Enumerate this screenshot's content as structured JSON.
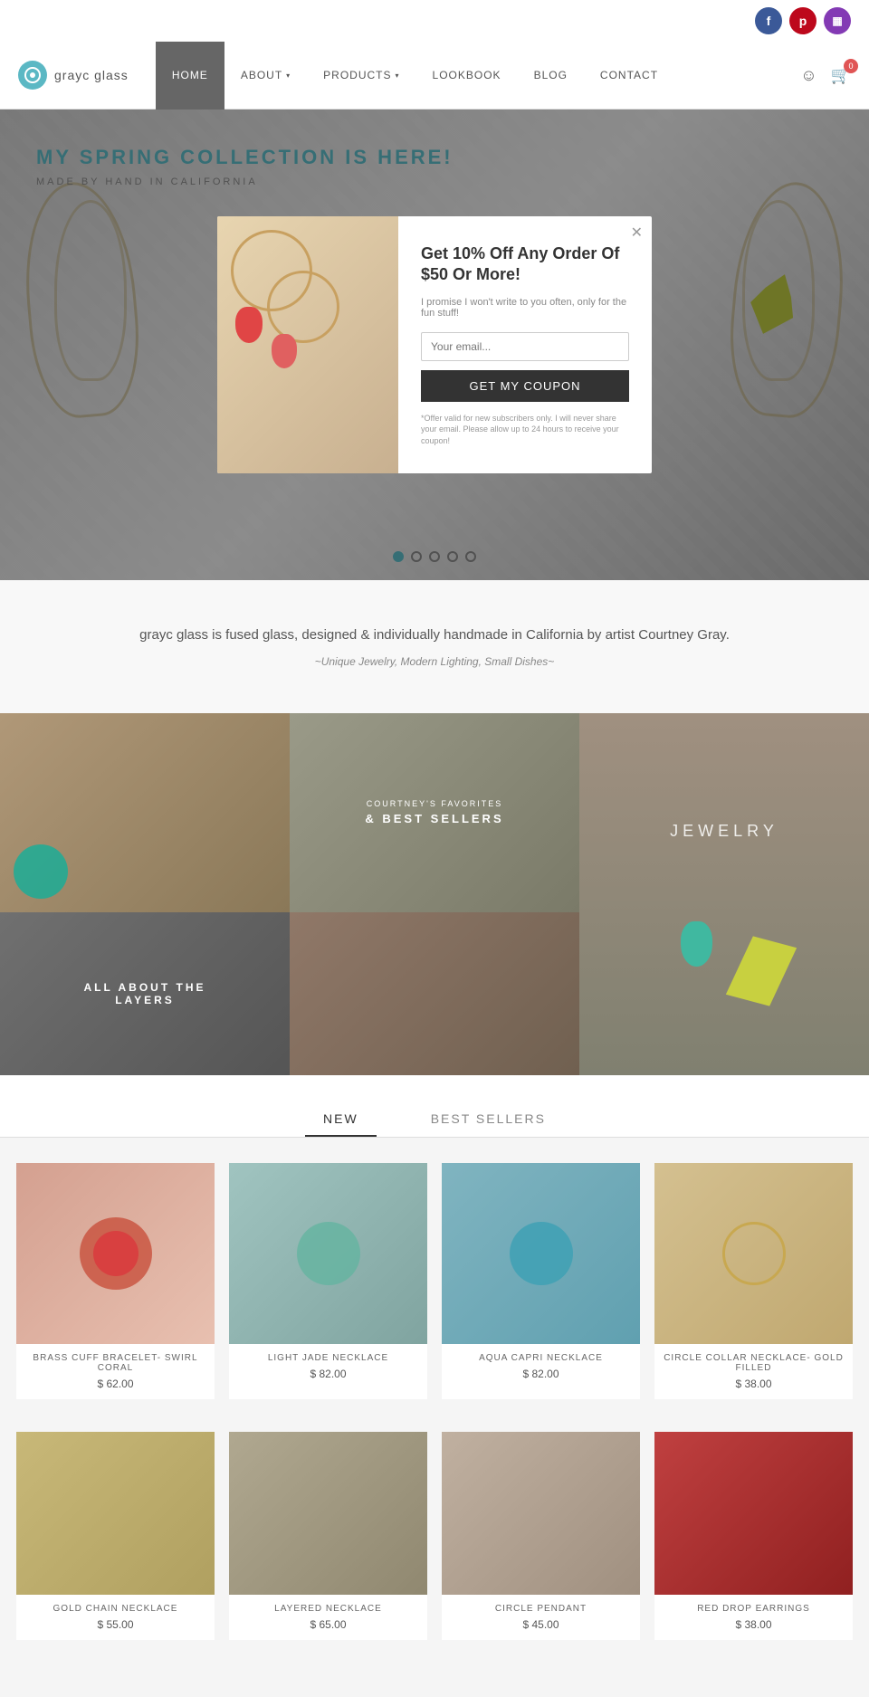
{
  "social": {
    "facebook_label": "f",
    "pinterest_label": "p",
    "instagram_label": "📷"
  },
  "nav": {
    "logo_text": "grayc glass",
    "items": [
      {
        "label": "HOME",
        "active": true
      },
      {
        "label": "ABOUT",
        "has_arrow": true,
        "active": false
      },
      {
        "label": "PRODUCTS",
        "has_arrow": true,
        "active": false
      },
      {
        "label": "LOOKBOOK",
        "active": false
      },
      {
        "label": "BLOG",
        "active": false
      },
      {
        "label": "CONTACT",
        "active": false
      }
    ],
    "cart_count": "0"
  },
  "hero": {
    "title": "MY SPRING COLLECTION IS HERE!",
    "subtitle": "MADE BY HAND IN CALIFORNIA"
  },
  "popup": {
    "title": "Get 10% Off Any Order Of $50 Or More!",
    "subtitle": "I promise I won't write to you often, only for the fun stuff!",
    "email_placeholder": "Your email...",
    "button_label": "Get My Coupon",
    "disclaimer": "*Offer valid for new subscribers only. I will never share your email. Please allow up to 24 hours to receive your coupon!"
  },
  "slider_dots": [
    {
      "active": true
    },
    {
      "active": false
    },
    {
      "active": false
    },
    {
      "active": false
    },
    {
      "active": false
    }
  ],
  "about": {
    "main_text": "grayc glass is fused glass, designed & individually handmade in California by artist Courtney Gray.",
    "sub_text": "~Unique Jewelry, Modern Lighting, Small Dishes~"
  },
  "grid_sections": {
    "cell1_label": "COURTNEY'S FAVORITES\n& BEST SELLERS",
    "cell2_label": "ALL ABOUT THE\nLAYERS",
    "cell3_label": "JEWELRY"
  },
  "tabs": {
    "items": [
      {
        "label": "NEW",
        "active": true
      },
      {
        "label": "BEST SELLERS",
        "active": false
      }
    ]
  },
  "products": [
    {
      "name": "BRASS CUFF BRACELET- SWIRL CORAL",
      "price": "$ 62.00",
      "color_class": "p-coral"
    },
    {
      "name": "LIGHT JADE NECKLACE",
      "price": "$ 82.00",
      "color_class": "p-jade"
    },
    {
      "name": "AQUA CAPRI NECKLACE",
      "price": "$ 82.00",
      "color_class": "p-aqua"
    },
    {
      "name": "CIRCLE COLLAR NECKLACE- GOLD FILLED",
      "price": "$ 38.00",
      "color_class": "p-gold"
    }
  ],
  "products_row2": [
    {
      "name": "GOLD CHAIN NECKLACE",
      "price": "$ 55.00",
      "color_class": "p-gold2"
    },
    {
      "name": "LAYERED NECKLACE",
      "price": "$ 65.00",
      "color_class": "p-necklace"
    },
    {
      "name": "CIRCLE PENDANT",
      "price": "$ 45.00",
      "color_class": "p-circle"
    },
    {
      "name": "RED DROP EARRINGS",
      "price": "$ 38.00",
      "color_class": "p-red"
    }
  ]
}
